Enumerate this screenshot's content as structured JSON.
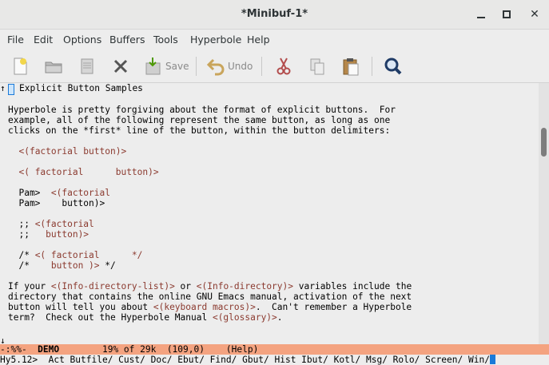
{
  "window": {
    "title": "*Minibuf-1*"
  },
  "menu": [
    "File",
    "Edit",
    "Options",
    "Buffers",
    "Tools",
    "Hyperbole",
    "Help"
  ],
  "toolbar": {
    "save_label": "Save",
    "undo_label": "Undo"
  },
  "editor": {
    "header": "Explicit Button Samples",
    "lines": [
      [
        {
          "t": "Hyperbole is pretty forgiving about the format of explicit buttons.  For"
        }
      ],
      [
        {
          "t": "example, all of the following represent the same button, as long as one"
        }
      ],
      [
        {
          "t": "clicks on the *first* line of the button, within the button delimiters:"
        }
      ],
      [
        {
          "t": ""
        }
      ],
      [
        {
          "t": "  "
        },
        {
          "t": "<(factorial button)>",
          "b": true
        }
      ],
      [
        {
          "t": ""
        }
      ],
      [
        {
          "t": "  "
        },
        {
          "t": "<( factorial      button)>",
          "b": true
        }
      ],
      [
        {
          "t": ""
        }
      ],
      [
        {
          "t": "  Pam>  "
        },
        {
          "t": "<(factorial",
          "b": true
        }
      ],
      [
        {
          "t": "  Pam>    button)>"
        }
      ],
      [
        {
          "t": ""
        }
      ],
      [
        {
          "t": "  ;; "
        },
        {
          "t": "<(factorial",
          "b": true
        }
      ],
      [
        {
          "t": "  ;;   "
        },
        {
          "t": "button)>",
          "b": true
        }
      ],
      [
        {
          "t": ""
        }
      ],
      [
        {
          "t": "  /* "
        },
        {
          "t": "<( factorial      */",
          "b": true
        }
      ],
      [
        {
          "t": "  /*    "
        },
        {
          "t": "button )>",
          "b": true
        },
        {
          "t": " */"
        }
      ],
      [
        {
          "t": ""
        }
      ],
      [
        {
          "t": "If your "
        },
        {
          "t": "<(Info-directory-list)>",
          "b": true
        },
        {
          "t": " or "
        },
        {
          "t": "<(Info-directory)>",
          "b": true
        },
        {
          "t": " variables include the"
        }
      ],
      [
        {
          "t": "directory that contains the online GNU Emacs manual, activation of the next"
        }
      ],
      [
        {
          "t": "button will tell you about "
        },
        {
          "t": "<(keyboard macros)>",
          "b": true
        },
        {
          "t": ".  Can't remember a Hyperbole"
        }
      ],
      [
        {
          "t": "term?  Check out the Hyperbole Manual "
        },
        {
          "t": "<(glossary)>",
          "b": true
        },
        {
          "t": "."
        }
      ]
    ]
  },
  "modeline": {
    "status": "-:%%-  ",
    "buffer": "DEMO",
    "position": "        19% of 29k  (109,0)    (Help)"
  },
  "minibuffer": {
    "text": "Hy5.12>  Act Butfile/ Cust/ Doc/ Ebut/ Find/ Gbut/ Hist Ibut/ Kotl/ Msg/ Rolo/ Screen/ Win/"
  },
  "colors": {
    "button_text": "#8b3a2f",
    "modeline_bg": "#f4a380",
    "cursor": "#1a7ad9"
  }
}
